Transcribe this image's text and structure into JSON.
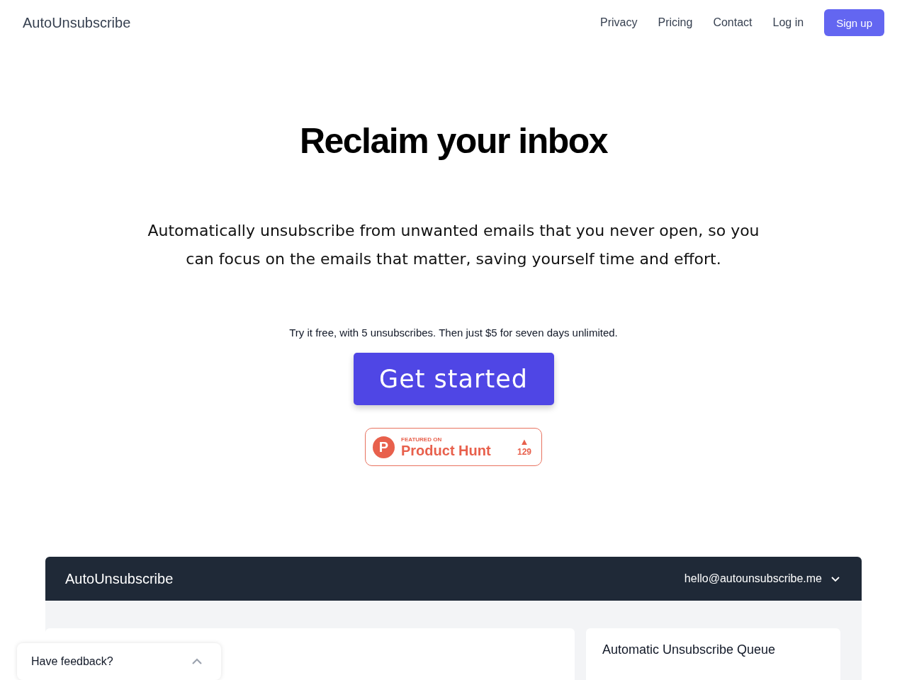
{
  "header": {
    "brand": "AutoUnsubscribe",
    "nav": [
      {
        "label": "Privacy"
      },
      {
        "label": "Pricing"
      },
      {
        "label": "Contact"
      },
      {
        "label": "Log in"
      }
    ],
    "signup": "Sign up"
  },
  "hero": {
    "title": "Reclaim your inbox",
    "subtitle": "Automatically unsubscribe from unwanted emails that you never open, so you can focus on the emails that matter, saving yourself time and effort.",
    "offer": "Try it free, with 5 unsubscribes. Then just $5 for seven days unlimited.",
    "cta": "Get started"
  },
  "product_hunt": {
    "logo": "P",
    "kicker": "FEATURED ON",
    "name": "Product Hunt",
    "arrow": "▲",
    "votes": "129"
  },
  "preview": {
    "brand": "AutoUnsubscribe",
    "account": "hello@autounsubscribe.me",
    "queue_title": "Automatic Unsubscribe Queue"
  },
  "feedback": {
    "label": "Have feedback?",
    "expanded": false
  }
}
